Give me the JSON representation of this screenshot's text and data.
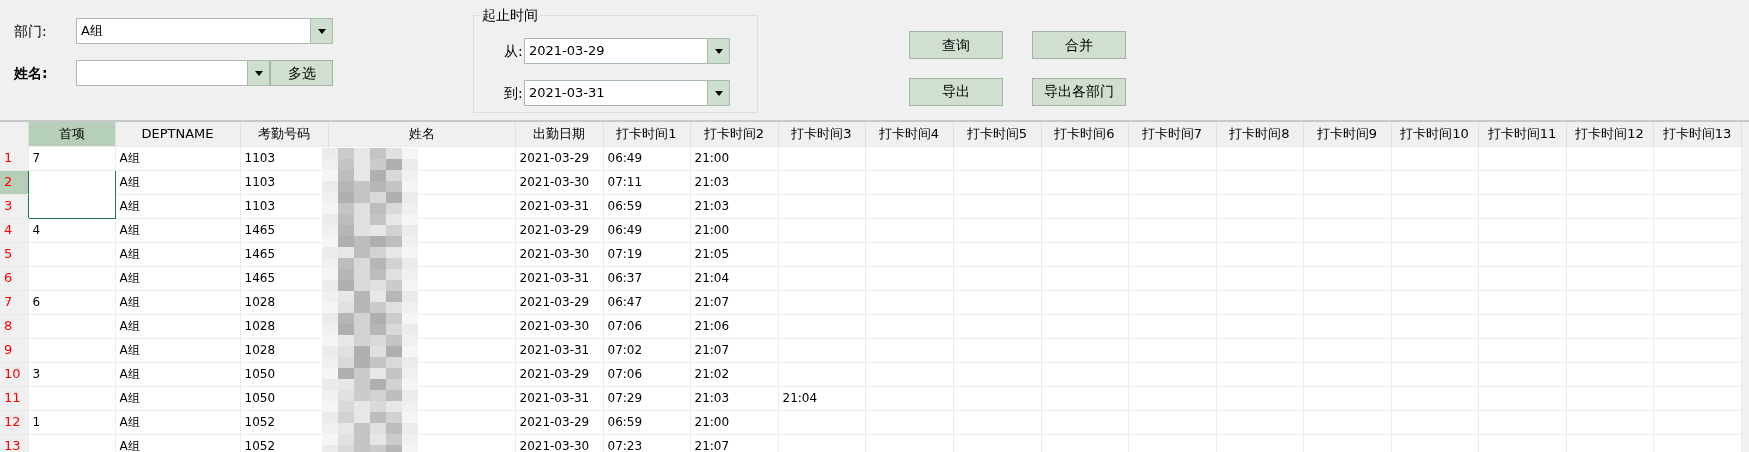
{
  "department": {
    "label": "部门:",
    "value": "A组"
  },
  "name_filter": {
    "label": "姓名:",
    "button": "多选"
  },
  "date_range": {
    "title": "起止时间",
    "from": {
      "label": "从:",
      "value": "2021-03-29"
    },
    "to": {
      "label": "到:",
      "value": "2021-03-31"
    }
  },
  "buttons": [
    "查询",
    "合并",
    "导出",
    "导出各部门"
  ],
  "table": {
    "columns": [
      {
        "label": "首项",
        "selected": true
      },
      {
        "label": "DEPTNAME",
        "selected": false
      },
      {
        "label": "考勤号码",
        "selected": false
      },
      {
        "label": "姓名",
        "selected": false
      },
      {
        "label": "出勤日期",
        "selected": false
      },
      {
        "label": "打卡时间1",
        "selected": false
      },
      {
        "label": "打卡时间2",
        "selected": false
      },
      {
        "label": "打卡时间3",
        "selected": false
      },
      {
        "label": "打卡时间4",
        "selected": false
      },
      {
        "label": "打卡时间5",
        "selected": false
      },
      {
        "label": "打卡时间6",
        "selected": false
      },
      {
        "label": "打卡时间7",
        "selected": false
      },
      {
        "label": "打卡时间8",
        "selected": false
      },
      {
        "label": "打卡时间9",
        "selected": false
      },
      {
        "label": "打卡时间10",
        "selected": false
      },
      {
        "label": "打卡时间11",
        "selected": false
      },
      {
        "label": "打卡时间12",
        "selected": false
      },
      {
        "label": "打卡时间13",
        "selected": false
      }
    ],
    "rows": [
      {
        "number": "1",
        "selected": false,
        "focused": false,
        "first_item": "7",
        "dept": "A组",
        "code": "1103",
        "date": "2021-03-29",
        "punches": [
          "06:49",
          "21:00"
        ]
      },
      {
        "number": "2",
        "selected": true,
        "focused": true,
        "dept": "A组",
        "code": "1103",
        "date": "2021-03-30",
        "punches": [
          "07:11",
          "21:03"
        ]
      },
      {
        "number": "3",
        "selected": false,
        "focused": true,
        "dept": "A组",
        "code": "1103",
        "date": "2021-03-31",
        "punches": [
          "06:59",
          "21:03"
        ]
      },
      {
        "number": "4",
        "selected": false,
        "focused": false,
        "first_item": "4",
        "dept": "A组",
        "code": "1465",
        "date": "2021-03-29",
        "punches": [
          "06:49",
          "21:00"
        ]
      },
      {
        "number": "5",
        "selected": false,
        "focused": false,
        "dept": "A组",
        "code": "1465",
        "date": "2021-03-30",
        "punches": [
          "07:19",
          "21:05"
        ]
      },
      {
        "number": "6",
        "selected": false,
        "focused": false,
        "dept": "A组",
        "code": "1465",
        "date": "2021-03-31",
        "punches": [
          "06:37",
          "21:04"
        ]
      },
      {
        "number": "7",
        "selected": false,
        "focused": false,
        "first_item": "6",
        "dept": "A组",
        "code": "1028",
        "date": "2021-03-29",
        "punches": [
          "06:47",
          "21:07"
        ]
      },
      {
        "number": "8",
        "selected": false,
        "focused": false,
        "dept": "A组",
        "code": "1028",
        "date": "2021-03-30",
        "punches": [
          "07:06",
          "21:06"
        ]
      },
      {
        "number": "9",
        "selected": false,
        "focused": false,
        "dept": "A组",
        "code": "1028",
        "date": "2021-03-31",
        "punches": [
          "07:02",
          "21:07"
        ]
      },
      {
        "number": "10",
        "selected": false,
        "focused": false,
        "first_item": "3",
        "dept": "A组",
        "code": "1050",
        "date": "2021-03-29",
        "punches": [
          "07:06",
          "21:02"
        ]
      },
      {
        "number": "11",
        "selected": false,
        "focused": false,
        "dept": "A组",
        "code": "1050",
        "date": "2021-03-31",
        "punches": [
          "07:29",
          "21:03",
          "21:04"
        ]
      },
      {
        "number": "12",
        "selected": false,
        "focused": false,
        "first_item": "1",
        "dept": "A组",
        "code": "1052",
        "date": "2021-03-29",
        "punches": [
          "06:59",
          "21:00"
        ]
      },
      {
        "number": "13",
        "selected": false,
        "focused": false,
        "dept": "A组",
        "code": "1052",
        "date": "2021-03-30",
        "punches": [
          "07:23",
          "21:07"
        ]
      }
    ]
  }
}
